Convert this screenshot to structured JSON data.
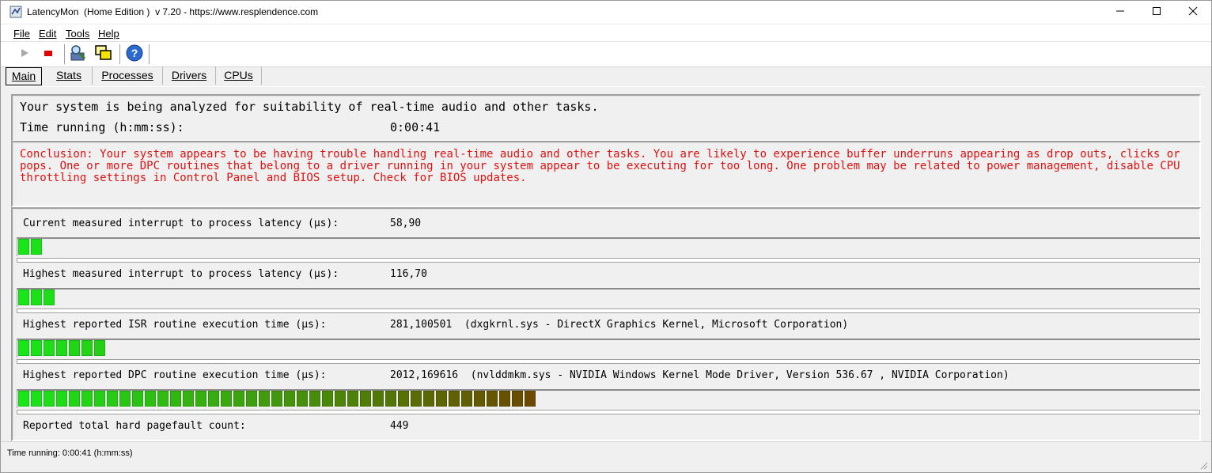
{
  "window": {
    "title": "LatencyMon  (Home Edition )  v 7.20 - https://www.resplendence.com"
  },
  "menu": [
    {
      "label": "File"
    },
    {
      "label": "Edit"
    },
    {
      "label": "Tools"
    },
    {
      "label": "Help"
    }
  ],
  "toolbar": {
    "icons": [
      "play-icon",
      "stop-icon",
      "find-driver-icon",
      "windows-icon",
      "help-icon"
    ]
  },
  "tabs": [
    {
      "label": "Main",
      "active": true
    },
    {
      "label": "Stats",
      "active": false
    },
    {
      "label": "Processes",
      "active": false
    },
    {
      "label": "Drivers",
      "active": false
    },
    {
      "label": "CPUs",
      "active": false
    }
  ],
  "summary": {
    "message": "Your system is being analyzed for suitability of real-time audio and other tasks.",
    "time_label": "Time running (h:mm:ss):",
    "time_value": "0:00:41"
  },
  "conclusion": "Conclusion: Your system appears to be having trouble handling real-time audio and other tasks. You are likely to experience buffer underruns appearing as drop outs, clicks or pops. One or more DPC routines that belong to a driver running in your system appear to be executing for too long. One problem may be related to power management, disable CPU throttling settings in Control Panel and BIOS setup. Check for BIOS updates.",
  "metrics": [
    {
      "label": "Current measured interrupt to process latency (µs):",
      "value": "58,90",
      "segments": 2
    },
    {
      "label": "Highest measured interrupt to process latency (µs):",
      "value": "116,70",
      "segments": 3
    },
    {
      "label": "Highest reported ISR routine execution time (µs):",
      "value": "281,100501  (dxgkrnl.sys - DirectX Graphics Kernel, Microsoft Corporation)",
      "segments": 7
    },
    {
      "label": "Highest reported DPC routine execution time (µs):",
      "value": "2012,169616  (nvlddmkm.sys - NVIDIA Windows Kernel Mode Driver, Version 536.67 , NVIDIA Corporation)",
      "segments": 41
    }
  ],
  "pagefault": {
    "label": "Reported total hard pagefault count:",
    "value": "449"
  },
  "status": "Time running: 0:00:41  (h:mm:ss)",
  "colors": {
    "bar_start": "#19e619",
    "bar_end": "#6b4a00",
    "conclusion_text": "#e01010"
  }
}
